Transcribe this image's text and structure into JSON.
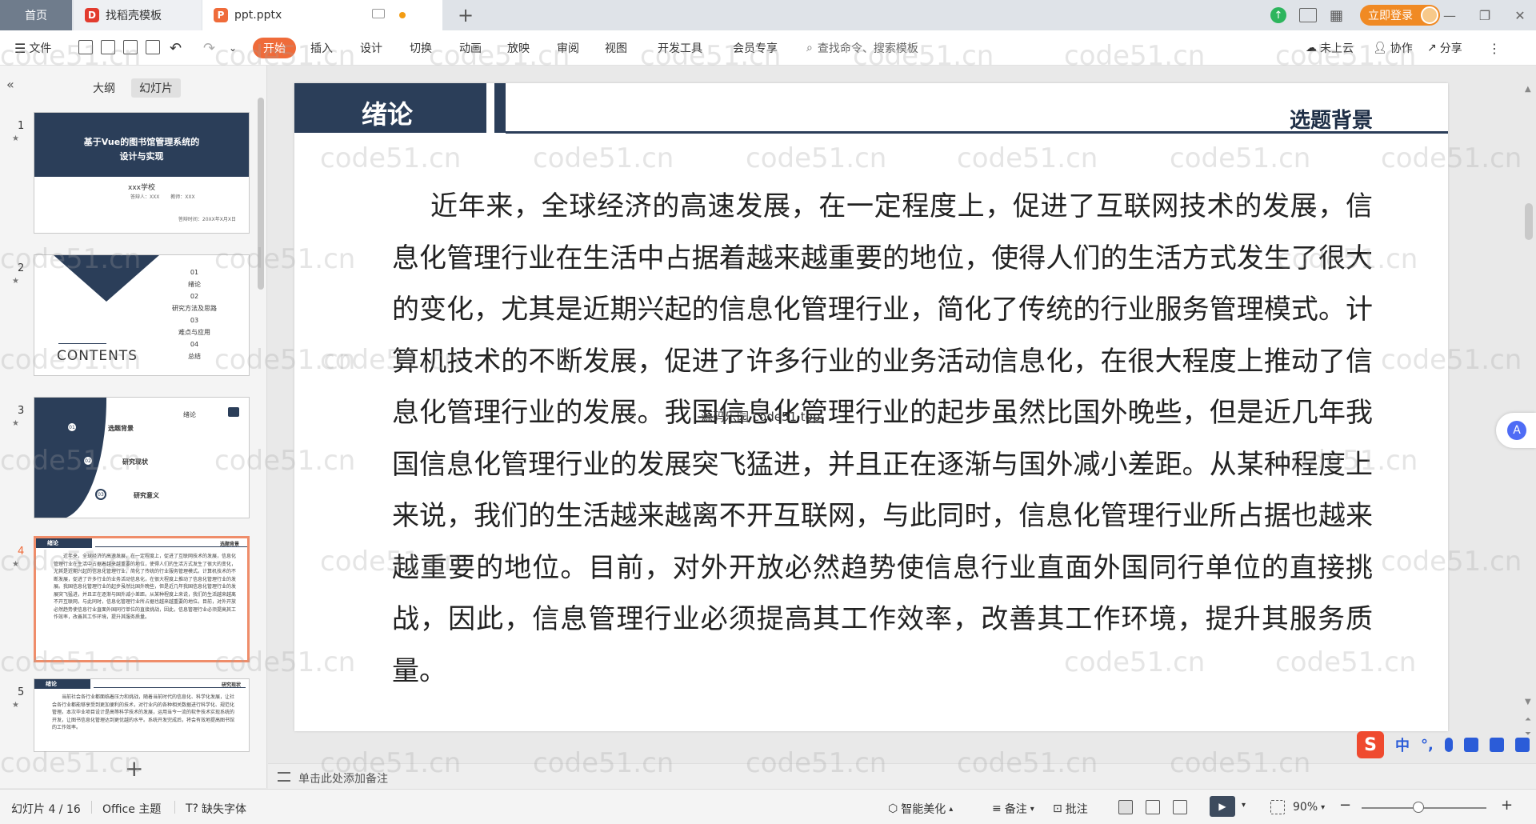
{
  "titlebar": {
    "tabs": [
      {
        "label": "首页"
      },
      {
        "label": "找稻壳模板"
      },
      {
        "label": "ppt.pptx"
      }
    ],
    "login_label": "立即登录"
  },
  "menubar": {
    "file_label": "文件",
    "tabs": [
      "开始",
      "插入",
      "设计",
      "切换",
      "动画",
      "放映",
      "审阅",
      "视图",
      "开发工具",
      "会员专享"
    ],
    "search_placeholder": "查找命令、搜索模板",
    "right": {
      "cloud": "未上云",
      "collab": "协作",
      "share": "分享"
    }
  },
  "leftpanel": {
    "tabs": [
      "大纲",
      "幻灯片"
    ],
    "numbers": [
      "1",
      "2",
      "3",
      "4",
      "5"
    ],
    "thumb1": {
      "title_line1": "基于Vue的图书馆管理系统的",
      "title_line2": "设计与实现",
      "school": "xxx学校",
      "meta": "答辩人：XXX　 　教师：XXX",
      "date": "答辩时间：20XX年X月X日"
    },
    "thumb2": {
      "items": [
        "01",
        "绪论",
        "02",
        "研究方法及思路",
        "03",
        "难点与应用",
        "04",
        "总结"
      ],
      "contents": "CONTENTS"
    },
    "thumb3": {
      "head": "绪论",
      "items": [
        "选题背景",
        "研究现状",
        "研究意义"
      ],
      "nums": [
        "01",
        "02",
        "03"
      ]
    },
    "thumb4": {
      "head": "绪论",
      "sub": "选题背景",
      "body": "近年来，全球经济的高速发展，在一定程度上，促进了互联网技术的发展，信息化管理行业在生活中占据着越来越重要的地位，使得人们的生活方式发生了很大的变化，尤其是近期兴起的信息化管理行业，简化了传统的行业服务管理模式。计算机技术的不断发展，促进了许多行业的业务活动信息化，在很大程度上推动了信息化管理行业的发展。我国信息化管理行业的起步虽然比国外晚些，但是近几年我国信息化管理行业的发展突飞猛进，并且正在逐渐与国外减小差距。从某种程度上来说，我们的生活越来越离不开互联网，与此同时，信息化管理行业所占据也越来越重要的地位。目前，对外开放必然趋势使信息行业直面外国同行单位的直接挑战，因此，信息管理行业必须提高其工作效率，改善其工作环境，提升其服务质量。"
    },
    "thumb5": {
      "head": "绪论",
      "sub": "研究现状",
      "body": "当前社会各行业都面临着压力和挑战，随着当前时代的信息化、科学化发展，让社会各行业都能够享受到更加便利的技术，对行业内的各种相关数据进行科学化、规范化管理。本次毕业项目设计是高等科学技术的发展，运用当今一流的软件技术实现系统的开发，让图书信息化管理达到更优越的水平。系统开发完成后，将会有效地提高图书馆的工作效率。"
    }
  },
  "slide": {
    "header": "绪论",
    "subtitle": "选题背景",
    "body": "近年来，全球经济的高速发展，在一定程度上，促进了互联网技术的发展，信息化管理行业在生活中占据着越来越重要的地位，使得人们的生活方式发生了很大的变化，尤其是近期兴起的信息化管理行业，简化了传统的行业服务管理模式。计算机技术的不断发展，促进了许多行业的业务活动信息化，在很大程度上推动了信息化管理行业的发展。我国信息化管理行业的起步虽然比国外晚些，但是近几年我国信息化管理行业的发展突飞猛进，并且正在逐渐与国外减小差距。从某种程度上来说，我们的生活越来越离不开互联网，与此同时，信息化管理行业所占据也越来越重要的地位。目前，对外开放必然趋势使信息行业直面外国同行单位的直接挑战，因此，信息管理行业必须提高其工作效率，改善其工作环境，提升其服务质量。",
    "overlay_text": "源码乐园 code51.top"
  },
  "watermark": "code51.cn",
  "notes_placeholder": "单击此处添加备注",
  "statusbar": {
    "slide_count": "幻灯片 4 / 16",
    "theme": "Office 主题",
    "missing_font": "缺失字体",
    "beautify": "智能美化",
    "notes": "备注",
    "comments": "批注",
    "zoom": "90%"
  },
  "ime": {
    "label": "中"
  },
  "colors": {
    "accent": "#ef6b3a",
    "navy": "#2b3e59"
  }
}
